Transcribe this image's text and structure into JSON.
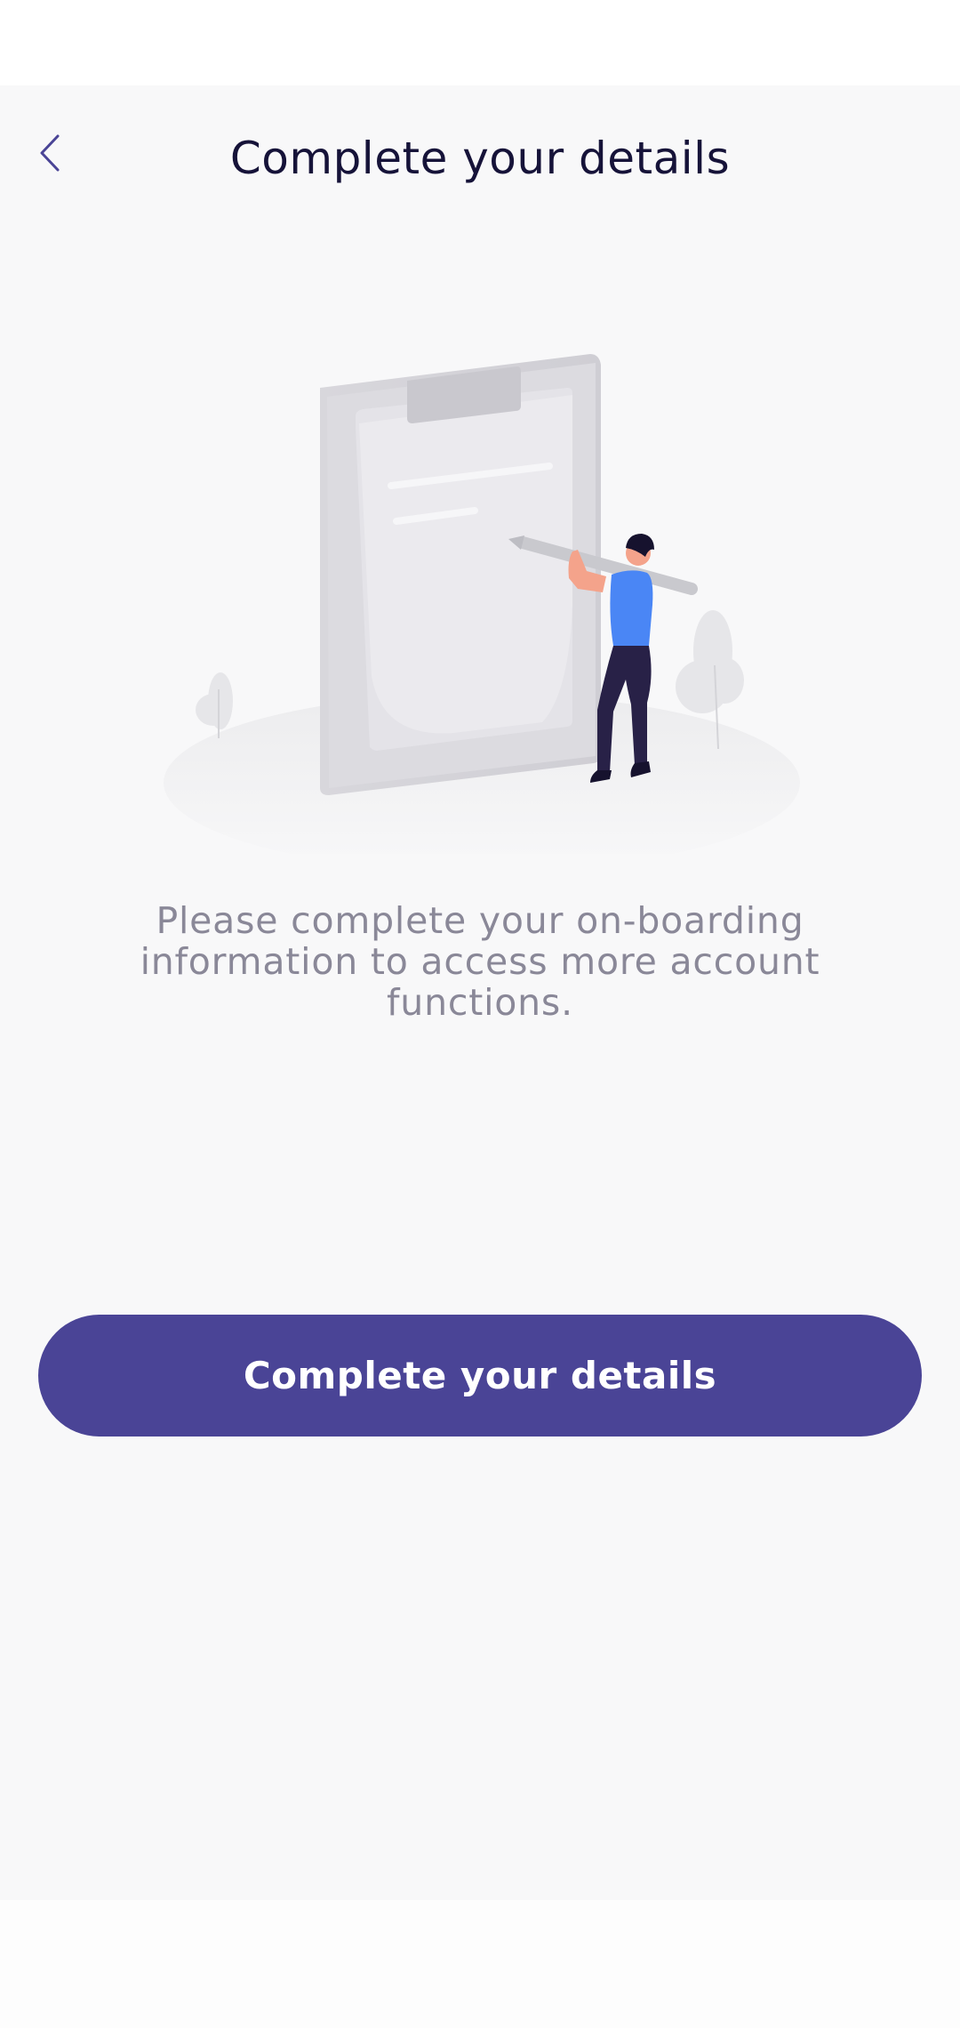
{
  "header": {
    "back_icon": "chevron-left-icon",
    "title": "Complete your details"
  },
  "main": {
    "illustration": "clipboard-with-person-holding-pencil",
    "description": "Please complete your on-boarding information to access more account functions.",
    "cta_label": "Complete your details"
  },
  "colors": {
    "background": "#f8f8f9",
    "title": "#161339",
    "description": "#8a8898",
    "button": "#4a4496",
    "button_text": "#ffffff",
    "accent_blue": "#4a86f5"
  }
}
